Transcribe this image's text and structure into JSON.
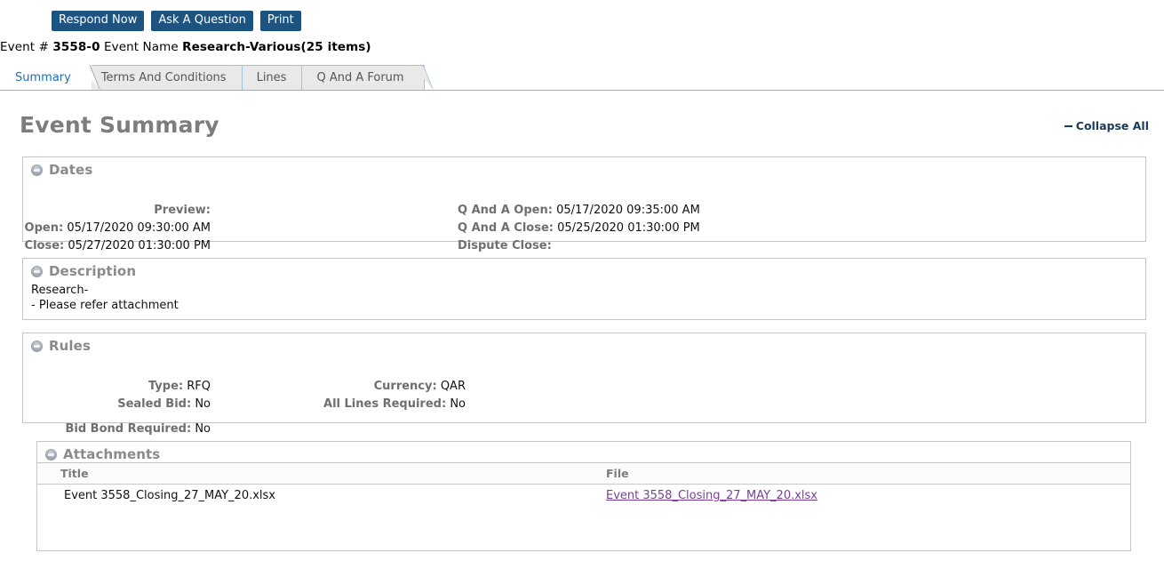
{
  "toolbar": {
    "buttons": [
      {
        "label": "Respond Now",
        "name": "respond-now-button"
      },
      {
        "label": "Ask A Question",
        "name": "ask-a-question-button"
      },
      {
        "label": "Print",
        "name": "print-button"
      }
    ]
  },
  "event": {
    "number_label": "Event #",
    "number_value": "3558-0",
    "name_label": "Event Name",
    "name_value": "Research-Various(25 items)"
  },
  "tabs": [
    {
      "label": "Summary",
      "active": true
    },
    {
      "label": "Terms And Conditions",
      "active": false
    },
    {
      "label": "Lines",
      "active": false
    },
    {
      "label": "Q And A Forum",
      "active": false
    }
  ],
  "page": {
    "title": "Event Summary",
    "collapse_all": "Collapse All"
  },
  "sections": {
    "dates": {
      "title": "Dates",
      "left": [
        {
          "label": "Preview:",
          "value": ""
        },
        {
          "label": "Open:",
          "value": "05/17/2020 09:30:00 AM"
        },
        {
          "label": "Close:",
          "value": "05/27/2020 01:30:00 PM"
        }
      ],
      "right": [
        {
          "label": "Q And A Open:",
          "value": "05/17/2020 09:35:00 AM"
        },
        {
          "label": "Q And A Close:",
          "value": "05/25/2020 01:30:00 PM"
        },
        {
          "label": "Dispute Close:",
          "value": ""
        }
      ]
    },
    "description": {
      "title": "Description",
      "text": "Research-\n- Please refer attachment"
    },
    "rules": {
      "title": "Rules",
      "left": [
        {
          "label": "Type:",
          "value": "RFQ"
        },
        {
          "label": "Sealed Bid:",
          "value": "No"
        },
        {
          "label": "Bid Bond Required:",
          "value": "No"
        }
      ],
      "right": [
        {
          "label": "Currency:",
          "value": "QAR"
        },
        {
          "label": "All Lines Required:",
          "value": "No"
        }
      ]
    },
    "attachments": {
      "title": "Attachments",
      "columns": [
        "Title",
        "File"
      ],
      "rows": [
        {
          "title": "Event 3558_Closing_27_MAY_20.xlsx",
          "file": "Event 3558_Closing_27_MAY_20.xlsx"
        }
      ]
    }
  },
  "colors": {
    "button_bg": "#1d5380",
    "active_tab_text": "#1f6fb4",
    "heading_gray": "#7d7d7d",
    "link_purple": "#7a3d9e"
  }
}
